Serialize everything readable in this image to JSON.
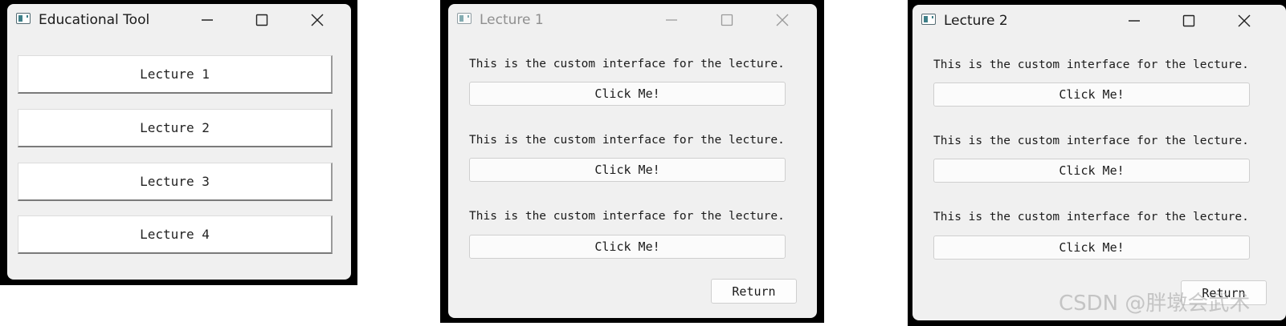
{
  "windows": {
    "main": {
      "title": "Educational Tool",
      "buttons": [
        "Lecture 1",
        "Lecture 2",
        "Lecture 3",
        "Lecture 4"
      ]
    },
    "lecture1": {
      "title": "Lecture 1",
      "state": "inactive",
      "label_text": "This is the custom interface for the lecture.",
      "button_text": "Click Me!",
      "return_label": "Return"
    },
    "lecture2": {
      "title": "Lecture 2",
      "state": "active",
      "label_text": "This is the custom interface for the lecture.",
      "button_text": "Click Me!",
      "return_label": "Return"
    }
  },
  "title_controls": [
    "minimize-icon",
    "maximize-icon",
    "close-icon"
  ],
  "watermark": "CSDN @胖墩会武术",
  "colors": {
    "window_bg": "#f0f0f0",
    "frame": "#000000",
    "inactive_text": "#8f8f8f"
  }
}
